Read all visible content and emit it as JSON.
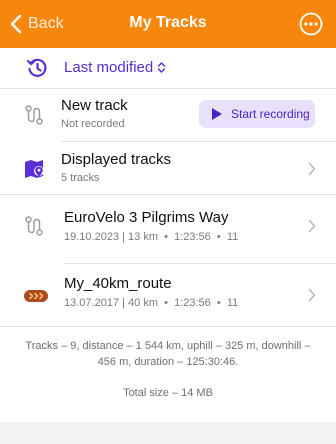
{
  "nav": {
    "back_label": "Back",
    "title": "My Tracks",
    "more_icon": "ellipsis-circle-icon",
    "color": "#f7860d"
  },
  "sort": {
    "icon": "history-icon",
    "label": "Last modified"
  },
  "new_track": {
    "title": "New track",
    "subtitle": "Not recorded",
    "record_button": "Start recording"
  },
  "displayed": {
    "title": "Displayed tracks",
    "subtitle": "5 tracks",
    "icon": "map-pin-icon"
  },
  "tracks": [
    {
      "name": "EuroVelo 3 Pilgrims Way",
      "date": "19.10.2023",
      "distance": "13 km",
      "duration": "1:23:56",
      "points": "11",
      "icon": "route-icon"
    },
    {
      "name": "My_40km_route",
      "date": "13.07.2017",
      "distance": "40 km",
      "duration": "1:23:56",
      "points": "11",
      "icon": "gpx-route-icon"
    }
  ],
  "summary": "Tracks – 9, distance – 1 544 km, uphill – 325 m, downhill – 456 m, duration – 125:30:46.",
  "total_size": "Total size – 14 MB",
  "colors": {
    "accent": "#5a2fd3",
    "brand_orange": "#f7860d",
    "route_brown": "#b04a1c"
  }
}
